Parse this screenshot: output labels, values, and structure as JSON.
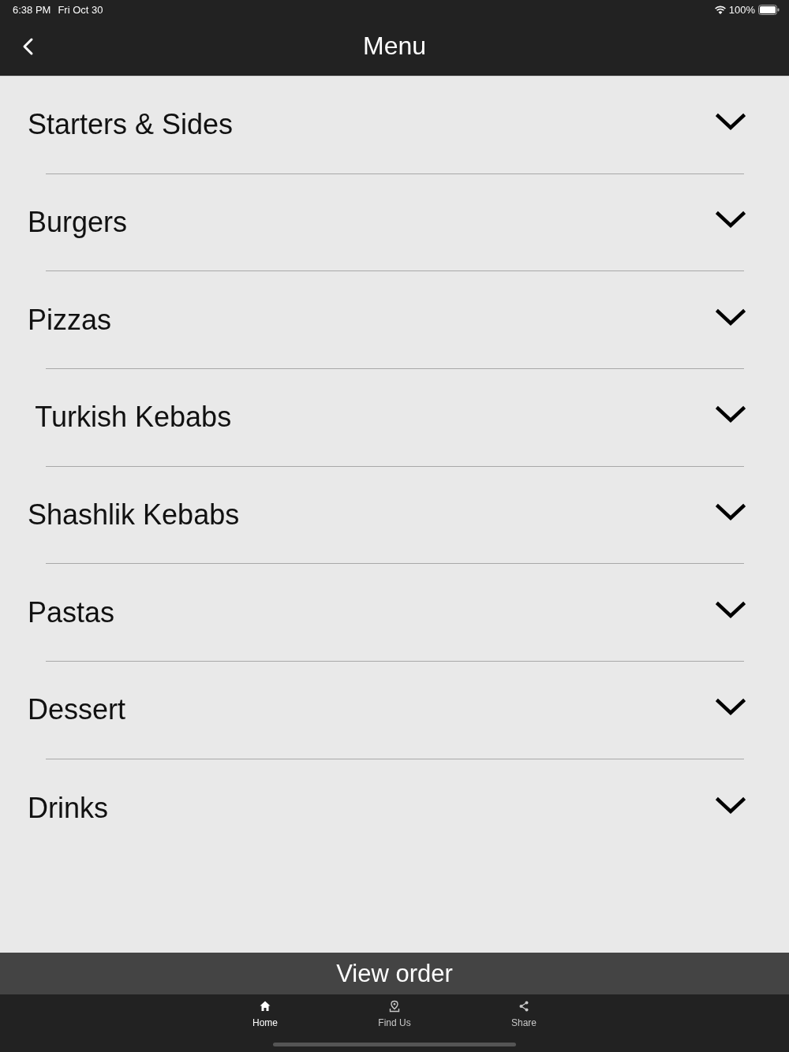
{
  "status_bar": {
    "time": "6:38 PM",
    "date": "Fri Oct 30",
    "battery": "100%"
  },
  "header": {
    "title": "Menu"
  },
  "categories": [
    {
      "label": "Starters & Sides",
      "expanded": false
    },
    {
      "label": "Burgers",
      "expanded": false
    },
    {
      "label": "Pizzas",
      "expanded": false
    },
    {
      "label": " Turkish Kebabs",
      "expanded": false
    },
    {
      "label": "Shashlik Kebabs",
      "expanded": false
    },
    {
      "label": "Pastas",
      "expanded": false
    },
    {
      "label": "Dessert",
      "expanded": false
    },
    {
      "label": "Drinks",
      "expanded": false
    }
  ],
  "order_button": {
    "label": "View order"
  },
  "tabs": [
    {
      "label": "Home",
      "selected": true
    },
    {
      "label": "Find Us",
      "selected": false
    },
    {
      "label": "Share",
      "selected": false
    }
  ]
}
